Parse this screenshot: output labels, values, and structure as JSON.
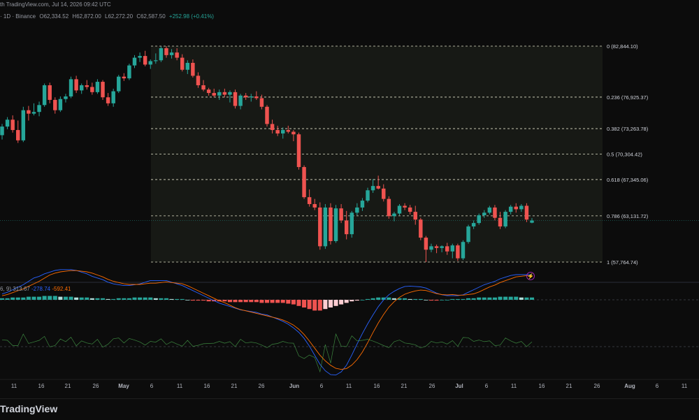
{
  "header": {
    "top_line": "th TradingView.com, Jul 14, 2026 09:42 UTC",
    "symbol_line": {
      "interval": "· 1D · Binance",
      "open": "O62,334.52",
      "high": "H62,872.00",
      "low": "L62,272.20",
      "close": "C62,587.50",
      "change": "+252.98 (+0.41%)"
    }
  },
  "indicator": {
    "params": "6, 9)",
    "hist_value": "313.67",
    "macd_value": "-278.74",
    "signal_value": "-592.41"
  },
  "fib_levels": [
    {
      "label": "0 (82,844.10)",
      "value": 82844.1
    },
    {
      "label": "0.236 (76,925.37)",
      "value": 76925.37
    },
    {
      "label": "0.382 (73,263.78)",
      "value": 73263.78
    },
    {
      "label": "0.5 (70,304.42)",
      "value": 70304.42
    },
    {
      "label": "0.618 (67,345.06)",
      "value": 67345.06
    },
    {
      "label": "0.786 (63,131.72)",
      "value": 63131.72
    },
    {
      "label": "1 (57,764.74)",
      "value": 57764.74
    }
  ],
  "x_axis": {
    "ticks": [
      "11",
      "16",
      "21",
      "26",
      "May",
      "6",
      "11",
      "16",
      "21",
      "26",
      "Jun",
      "6",
      "11",
      "16",
      "21",
      "26",
      "Jul",
      "6",
      "11",
      "16",
      "21",
      "26",
      "Aug",
      "6",
      "11"
    ]
  },
  "footer": {
    "brand": "TradingView"
  },
  "colors": {
    "up": "#26a69a",
    "down": "#ef5350",
    "bg": "#0c0c0c",
    "fib_zone": "#1a1c17"
  },
  "chart_data": {
    "type": "candlestick",
    "candles": [
      {
        "o": 72500,
        "h": 73800,
        "l": 72000,
        "c": 73500
      },
      {
        "o": 73500,
        "h": 74600,
        "l": 73200,
        "c": 74300
      },
      {
        "o": 74300,
        "h": 74800,
        "l": 72800,
        "c": 73100
      },
      {
        "o": 73100,
        "h": 74200,
        "l": 71600,
        "c": 71900
      },
      {
        "o": 71900,
        "h": 75800,
        "l": 71700,
        "c": 75400
      },
      {
        "o": 75400,
        "h": 75900,
        "l": 74200,
        "c": 75000
      },
      {
        "o": 75000,
        "h": 76200,
        "l": 74800,
        "c": 75200
      },
      {
        "o": 75200,
        "h": 76400,
        "l": 74700,
        "c": 76000
      },
      {
        "o": 76000,
        "h": 78500,
        "l": 75800,
        "c": 78300
      },
      {
        "o": 78300,
        "h": 78600,
        "l": 76200,
        "c": 76600
      },
      {
        "o": 76600,
        "h": 76900,
        "l": 75000,
        "c": 75400
      },
      {
        "o": 75400,
        "h": 77000,
        "l": 75200,
        "c": 76700
      },
      {
        "o": 76700,
        "h": 77300,
        "l": 76300,
        "c": 77000
      },
      {
        "o": 77000,
        "h": 79300,
        "l": 76800,
        "c": 79000
      },
      {
        "o": 79000,
        "h": 79400,
        "l": 77400,
        "c": 77700
      },
      {
        "o": 77700,
        "h": 78500,
        "l": 77300,
        "c": 78300
      },
      {
        "o": 78300,
        "h": 78900,
        "l": 77800,
        "c": 78100
      },
      {
        "o": 78100,
        "h": 78600,
        "l": 77200,
        "c": 77500
      },
      {
        "o": 77500,
        "h": 79000,
        "l": 77300,
        "c": 78700
      },
      {
        "o": 78700,
        "h": 78900,
        "l": 76600,
        "c": 76900
      },
      {
        "o": 76900,
        "h": 77400,
        "l": 75900,
        "c": 76200
      },
      {
        "o": 76200,
        "h": 77900,
        "l": 75800,
        "c": 77600
      },
      {
        "o": 77600,
        "h": 79500,
        "l": 77400,
        "c": 79300
      },
      {
        "o": 79300,
        "h": 79700,
        "l": 78800,
        "c": 79100
      },
      {
        "o": 79100,
        "h": 80800,
        "l": 78900,
        "c": 80600
      },
      {
        "o": 80600,
        "h": 81800,
        "l": 80300,
        "c": 81500
      },
      {
        "o": 81500,
        "h": 82100,
        "l": 81000,
        "c": 81700
      },
      {
        "o": 81700,
        "h": 82300,
        "l": 80500,
        "c": 80700
      },
      {
        "o": 80700,
        "h": 81300,
        "l": 80200,
        "c": 81100
      },
      {
        "o": 81100,
        "h": 82000,
        "l": 80800,
        "c": 81200
      },
      {
        "o": 81200,
        "h": 82800,
        "l": 81000,
        "c": 82600
      },
      {
        "o": 82600,
        "h": 82844,
        "l": 81500,
        "c": 81800
      },
      {
        "o": 81800,
        "h": 82500,
        "l": 81400,
        "c": 82100
      },
      {
        "o": 82100,
        "h": 82600,
        "l": 81200,
        "c": 81500
      },
      {
        "o": 81500,
        "h": 81900,
        "l": 79900,
        "c": 80100
      },
      {
        "o": 80100,
        "h": 81200,
        "l": 79600,
        "c": 80900
      },
      {
        "o": 80900,
        "h": 81300,
        "l": 79200,
        "c": 79400
      },
      {
        "o": 79400,
        "h": 79800,
        "l": 78000,
        "c": 78300
      },
      {
        "o": 78300,
        "h": 78900,
        "l": 77600,
        "c": 77800
      },
      {
        "o": 77800,
        "h": 78000,
        "l": 77100,
        "c": 77400
      },
      {
        "o": 77400,
        "h": 77900,
        "l": 76900,
        "c": 77100
      },
      {
        "o": 77100,
        "h": 77800,
        "l": 76600,
        "c": 77500
      },
      {
        "o": 77500,
        "h": 77900,
        "l": 76900,
        "c": 77200
      },
      {
        "o": 77200,
        "h": 77700,
        "l": 76300,
        "c": 77500
      },
      {
        "o": 77500,
        "h": 77800,
        "l": 75600,
        "c": 75900
      },
      {
        "o": 75900,
        "h": 77300,
        "l": 75500,
        "c": 77100
      },
      {
        "o": 77100,
        "h": 77400,
        "l": 76600,
        "c": 76900
      },
      {
        "o": 76900,
        "h": 77300,
        "l": 76400,
        "c": 77000
      },
      {
        "o": 77000,
        "h": 77600,
        "l": 76600,
        "c": 76800
      },
      {
        "o": 76800,
        "h": 77200,
        "l": 75500,
        "c": 75800
      },
      {
        "o": 75800,
        "h": 76000,
        "l": 73500,
        "c": 73800
      },
      {
        "o": 73800,
        "h": 74300,
        "l": 72700,
        "c": 73100
      },
      {
        "o": 73100,
        "h": 73600,
        "l": 72400,
        "c": 72700
      },
      {
        "o": 72700,
        "h": 73400,
        "l": 72100,
        "c": 73100
      },
      {
        "o": 73100,
        "h": 73600,
        "l": 72700,
        "c": 72900
      },
      {
        "o": 72900,
        "h": 73100,
        "l": 71800,
        "c": 72600
      },
      {
        "o": 72600,
        "h": 72800,
        "l": 68500,
        "c": 68800
      },
      {
        "o": 68800,
        "h": 69000,
        "l": 65100,
        "c": 65300
      },
      {
        "o": 65300,
        "h": 66200,
        "l": 64200,
        "c": 64500
      },
      {
        "o": 64500,
        "h": 65100,
        "l": 63800,
        "c": 64100
      },
      {
        "o": 64100,
        "h": 64700,
        "l": 59200,
        "c": 59600
      },
      {
        "o": 59600,
        "h": 64500,
        "l": 59300,
        "c": 64100
      },
      {
        "o": 64100,
        "h": 64600,
        "l": 59800,
        "c": 60200
      },
      {
        "o": 60200,
        "h": 64400,
        "l": 60000,
        "c": 64000
      },
      {
        "o": 64000,
        "h": 64500,
        "l": 62300,
        "c": 62600
      },
      {
        "o": 62600,
        "h": 63700,
        "l": 60400,
        "c": 61000
      },
      {
        "o": 61000,
        "h": 63700,
        "l": 60600,
        "c": 63500
      },
      {
        "o": 63500,
        "h": 64600,
        "l": 63200,
        "c": 64100
      },
      {
        "o": 64100,
        "h": 65200,
        "l": 63700,
        "c": 64900
      },
      {
        "o": 64900,
        "h": 66400,
        "l": 64700,
        "c": 66100
      },
      {
        "o": 66100,
        "h": 67400,
        "l": 65800,
        "c": 66600
      },
      {
        "o": 66600,
        "h": 67800,
        "l": 66200,
        "c": 66300
      },
      {
        "o": 66300,
        "h": 66800,
        "l": 64800,
        "c": 65100
      },
      {
        "o": 65100,
        "h": 65400,
        "l": 62800,
        "c": 63100
      },
      {
        "o": 63100,
        "h": 63600,
        "l": 62500,
        "c": 63400
      },
      {
        "o": 63400,
        "h": 64500,
        "l": 63200,
        "c": 64300
      },
      {
        "o": 64300,
        "h": 64600,
        "l": 63800,
        "c": 64100
      },
      {
        "o": 64100,
        "h": 64400,
        "l": 63300,
        "c": 63600
      },
      {
        "o": 63600,
        "h": 64300,
        "l": 62100,
        "c": 62700
      },
      {
        "o": 62700,
        "h": 62900,
        "l": 60300,
        "c": 60600
      },
      {
        "o": 60600,
        "h": 60800,
        "l": 57765,
        "c": 59200
      },
      {
        "o": 59200,
        "h": 59900,
        "l": 58900,
        "c": 59600
      },
      {
        "o": 59600,
        "h": 59800,
        "l": 58800,
        "c": 59400
      },
      {
        "o": 59400,
        "h": 59700,
        "l": 58900,
        "c": 59600
      },
      {
        "o": 59600,
        "h": 60000,
        "l": 58600,
        "c": 59000
      },
      {
        "o": 59000,
        "h": 59900,
        "l": 58200,
        "c": 59700
      },
      {
        "o": 59700,
        "h": 59900,
        "l": 57900,
        "c": 58200
      },
      {
        "o": 58200,
        "h": 60300,
        "l": 58000,
        "c": 60100
      },
      {
        "o": 60100,
        "h": 62100,
        "l": 59900,
        "c": 61900
      },
      {
        "o": 61900,
        "h": 62600,
        "l": 61600,
        "c": 62300
      },
      {
        "o": 62300,
        "h": 63400,
        "l": 62100,
        "c": 63200
      },
      {
        "o": 63200,
        "h": 63800,
        "l": 62900,
        "c": 63500
      },
      {
        "o": 63500,
        "h": 64300,
        "l": 63300,
        "c": 64100
      },
      {
        "o": 64100,
        "h": 64400,
        "l": 62600,
        "c": 62900
      },
      {
        "o": 62900,
        "h": 63600,
        "l": 61600,
        "c": 61900
      },
      {
        "o": 61900,
        "h": 63800,
        "l": 61700,
        "c": 63600
      },
      {
        "o": 63600,
        "h": 64400,
        "l": 63300,
        "c": 64200
      },
      {
        "o": 64200,
        "h": 64600,
        "l": 63500,
        "c": 63900
      },
      {
        "o": 63900,
        "h": 64500,
        "l": 63600,
        "c": 64300
      },
      {
        "o": 64300,
        "h": 64600,
        "l": 62400,
        "c": 62700
      },
      {
        "o": 62334.52,
        "h": 62872.0,
        "l": 62272.2,
        "c": 62587.5
      }
    ],
    "macd_hist": [
      2,
      2,
      3,
      3,
      3,
      4,
      4,
      4,
      5,
      5,
      5,
      4,
      4,
      4,
      3,
      3,
      3,
      2,
      2,
      2,
      1,
      1,
      2,
      2,
      2,
      3,
      3,
      3,
      3,
      2,
      2,
      2,
      1,
      1,
      1,
      0,
      -1,
      -1,
      -1,
      -2,
      -2,
      -2,
      -2,
      -3,
      -3,
      -3,
      -3,
      -3,
      -3,
      -4,
      -4,
      -4,
      -4,
      -4,
      -5,
      -6,
      -8,
      -10,
      -12,
      -14,
      -14,
      -12,
      -10,
      -8,
      -6,
      -4,
      -2,
      -1,
      0,
      1,
      2,
      3,
      3,
      3,
      2,
      2,
      2,
      1,
      1,
      1,
      0,
      -1,
      -1,
      0,
      0,
      1,
      1,
      1,
      2,
      2,
      3,
      3,
      3,
      3,
      4,
      4,
      4,
      4,
      3,
      3,
      3
    ],
    "price_ylim": [
      55000,
      84500
    ]
  }
}
